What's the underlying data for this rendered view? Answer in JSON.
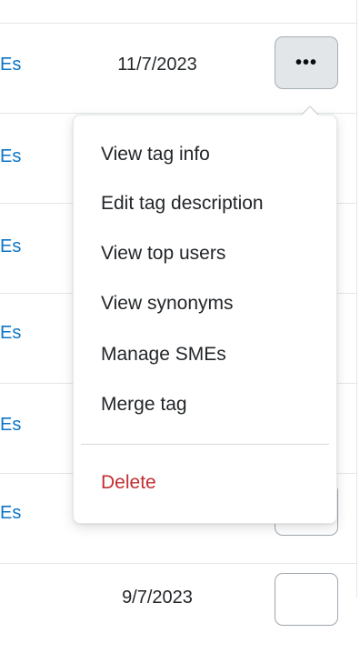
{
  "table": {
    "rows": [
      {
        "sme_label": "Es",
        "date": "11/7/2023",
        "more_label": "•••"
      },
      {
        "sme_label": "Es",
        "date": "",
        "more_label": ""
      },
      {
        "sme_label": "Es",
        "date": "",
        "more_label": ""
      },
      {
        "sme_label": "Es",
        "date": "",
        "more_label": ""
      },
      {
        "sme_label": "Es",
        "date": "",
        "more_label": ""
      },
      {
        "sme_label": "Es",
        "date": "",
        "more_label": ""
      },
      {
        "sme_label": "",
        "date": "9/7/2023",
        "more_label": ""
      }
    ]
  },
  "menu": {
    "items": [
      {
        "label": "View tag info"
      },
      {
        "label": "Edit tag description"
      },
      {
        "label": "View top users"
      },
      {
        "label": "View synonyms"
      },
      {
        "label": "Manage SMEs"
      },
      {
        "label": "Merge tag"
      }
    ],
    "delete_label": "Delete"
  },
  "colors": {
    "link": "#0a74c7",
    "danger": "#c22e32",
    "active_button": "#e3e6e8",
    "border": "#e3e6e8"
  }
}
